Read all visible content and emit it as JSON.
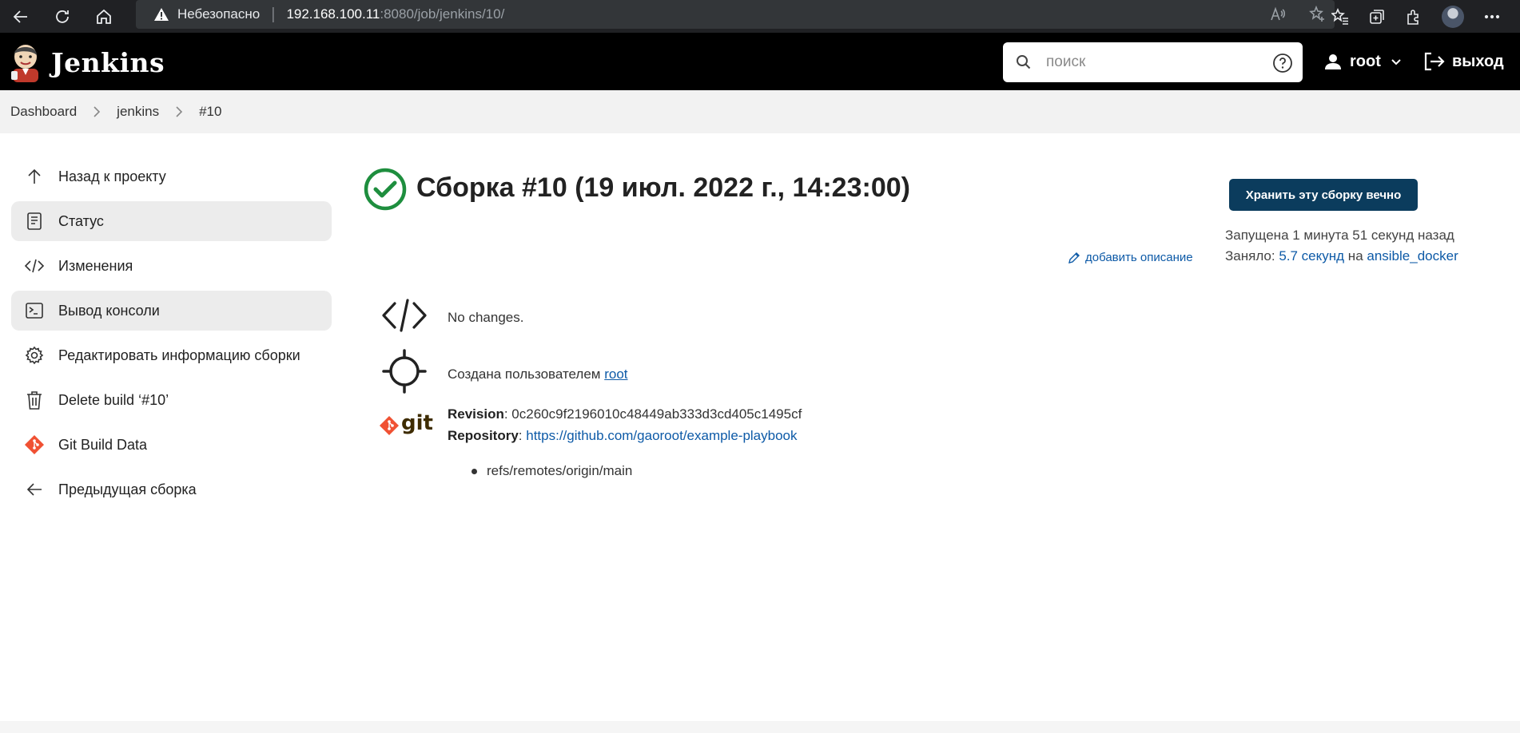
{
  "browser": {
    "insecure_label": "Небезопасно",
    "url_host": "192.168.100.11",
    "url_path": ":8080/job/jenkins/10/"
  },
  "header": {
    "brand": "Jenkins",
    "search_placeholder": "поиск",
    "user": "root",
    "logout": "выход"
  },
  "breadcrumb": [
    "Dashboard",
    "jenkins",
    "#10"
  ],
  "sidebar": {
    "items": [
      {
        "label": "Назад к проекту",
        "icon": "arrow-up-icon"
      },
      {
        "label": "Статус",
        "icon": "document-icon",
        "active": true
      },
      {
        "label": "Изменения",
        "icon": "code-icon"
      },
      {
        "label": "Вывод консоли",
        "icon": "terminal-icon",
        "active": true
      },
      {
        "label": "Редактировать информацию сборки",
        "icon": "gear-icon"
      },
      {
        "label": "Delete build ‘#10’",
        "icon": "trash-icon"
      },
      {
        "label": "Git Build Data",
        "icon": "git-icon"
      },
      {
        "label": "Предыдущая сборка",
        "icon": "arrow-left-icon"
      }
    ]
  },
  "main": {
    "title": "Сборка #10 (19 июл. 2022 г., 14:23:00)",
    "keep_button": "Хранить эту сборку вечно",
    "started_ago": "Запущена 1 минута 51 секунд назад",
    "took_prefix": "Заняло: ",
    "took_duration": "5.7 секунд",
    "took_on": " на ",
    "took_agent": "ansible_docker",
    "add_description": "добавить описание",
    "no_changes": "No changes.",
    "started_by_prefix": "Создана пользователем ",
    "started_by_user": "root",
    "git_logo_text": "git",
    "revision_label": "Revision",
    "revision_value": ": 0c260c9f2196010c48449ab333d3cd405c1495cf",
    "repository_label": "Repository",
    "repository_sep": ": ",
    "repository_url": "https://github.com/gaoroot/example-playbook",
    "refs": [
      "refs/remotes/origin/main"
    ]
  },
  "colors": {
    "header_bg": "#000000",
    "button_bg": "#0b3c5d",
    "success_green": "#1e8e3e",
    "link_blue": "#0d5aa7",
    "git_orange": "#f05133"
  }
}
